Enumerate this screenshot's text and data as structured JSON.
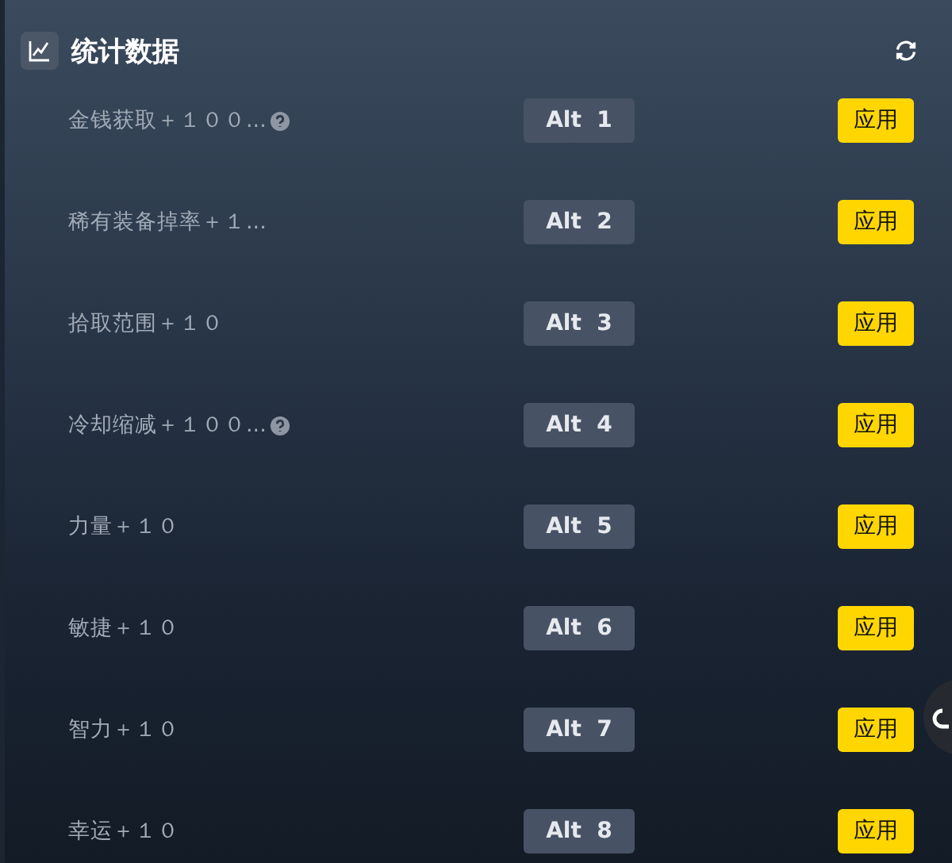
{
  "header": {
    "title": "统计数据"
  },
  "cheats": [
    {
      "label": "金钱获取＋１００...",
      "hint": true,
      "hotkey": "Alt  1",
      "action": "应用"
    },
    {
      "label": "稀有装备掉率＋１...",
      "hint": false,
      "hotkey": "Alt  2",
      "action": "应用"
    },
    {
      "label": "拾取范围＋１０",
      "hint": false,
      "hotkey": "Alt  3",
      "action": "应用"
    },
    {
      "label": "冷却缩减＋１００...",
      "hint": true,
      "hotkey": "Alt  4",
      "action": "应用"
    },
    {
      "label": "力量＋１０",
      "hint": false,
      "hotkey": "Alt  5",
      "action": "应用"
    },
    {
      "label": "敏捷＋１０",
      "hint": false,
      "hotkey": "Alt  6",
      "action": "应用"
    },
    {
      "label": "智力＋１０",
      "hint": false,
      "hotkey": "Alt  7",
      "action": "应用"
    },
    {
      "label": "幸运＋１０",
      "hint": false,
      "hotkey": "Alt  8",
      "action": "应用"
    }
  ]
}
